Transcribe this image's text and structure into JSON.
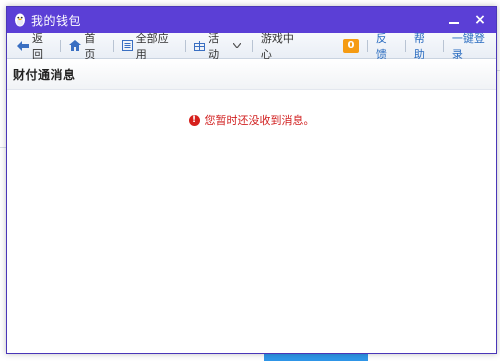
{
  "window": {
    "title": "我的钱包",
    "accent_color": "#5b3fd6",
    "controls": {
      "minimize_icon": "minimize-icon",
      "close_icon": "close-icon",
      "close_label": "×"
    }
  },
  "toolbar": {
    "back_label": "返回",
    "home_label": "首页",
    "all_apps_label": "全部应用",
    "activity_label": "活动",
    "games_label": "游戏中心",
    "badge_count": "0",
    "feedback_label": "反馈",
    "help_label": "帮助",
    "login_label": "一键登录"
  },
  "section": {
    "title": "财付通消息"
  },
  "content": {
    "empty_message": "您暂时还没收到消息。",
    "empty_icon": "warning-icon"
  }
}
